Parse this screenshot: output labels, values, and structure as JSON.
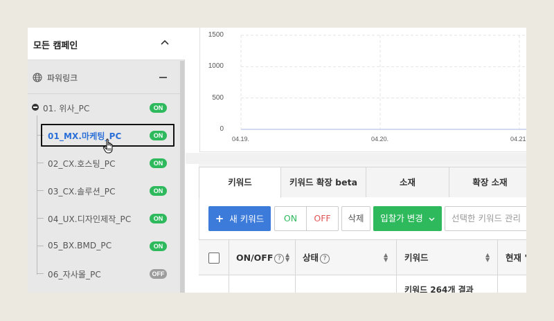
{
  "sidebar": {
    "title": "모든 캠페인",
    "group_label": "파워링크",
    "campaign": {
      "label": "01. 위사_PC",
      "status": "ON"
    },
    "adgroups": [
      {
        "label": "01_MX.마케팅_PC",
        "status": "ON"
      },
      {
        "label": "02_CX.호스팅_PC",
        "status": "ON"
      },
      {
        "label": "03_CX.솔루션_PC",
        "status": "ON"
      },
      {
        "label": "04_UX.디자인제작_PC",
        "status": "ON"
      },
      {
        "label": "05_BX.BMD_PC",
        "status": "ON"
      },
      {
        "label": "06_자사몰_PC",
        "status": "OFF"
      }
    ]
  },
  "chart_data": {
    "type": "line",
    "x_ticks": [
      "04.19.",
      "04.20.",
      "04.21"
    ],
    "y_ticks": [
      "1500",
      "1000",
      "500",
      "0"
    ],
    "ylim": [
      0,
      1500
    ],
    "grid": true
  },
  "tabs": [
    "키워드",
    "키워드 확장 beta",
    "소재",
    "확장 소재"
  ],
  "toolbar": {
    "new_keyword": "새 키워드",
    "plus": "+",
    "on": "ON",
    "off": "OFF",
    "delete": "삭제",
    "bid_change": "입찰가 변경",
    "manage_placeholder": "선택한 키워드 관리"
  },
  "table": {
    "headers": [
      "ON/OFF",
      "상태",
      "키워드",
      "현재 '"
    ],
    "help_mark": "?",
    "first_row_keyword": "키워드 264개 결과"
  },
  "colors": {
    "accent_blue": "#3c7bd9",
    "status_on": "#2fb95d",
    "status_off": "#9c9c9c"
  }
}
